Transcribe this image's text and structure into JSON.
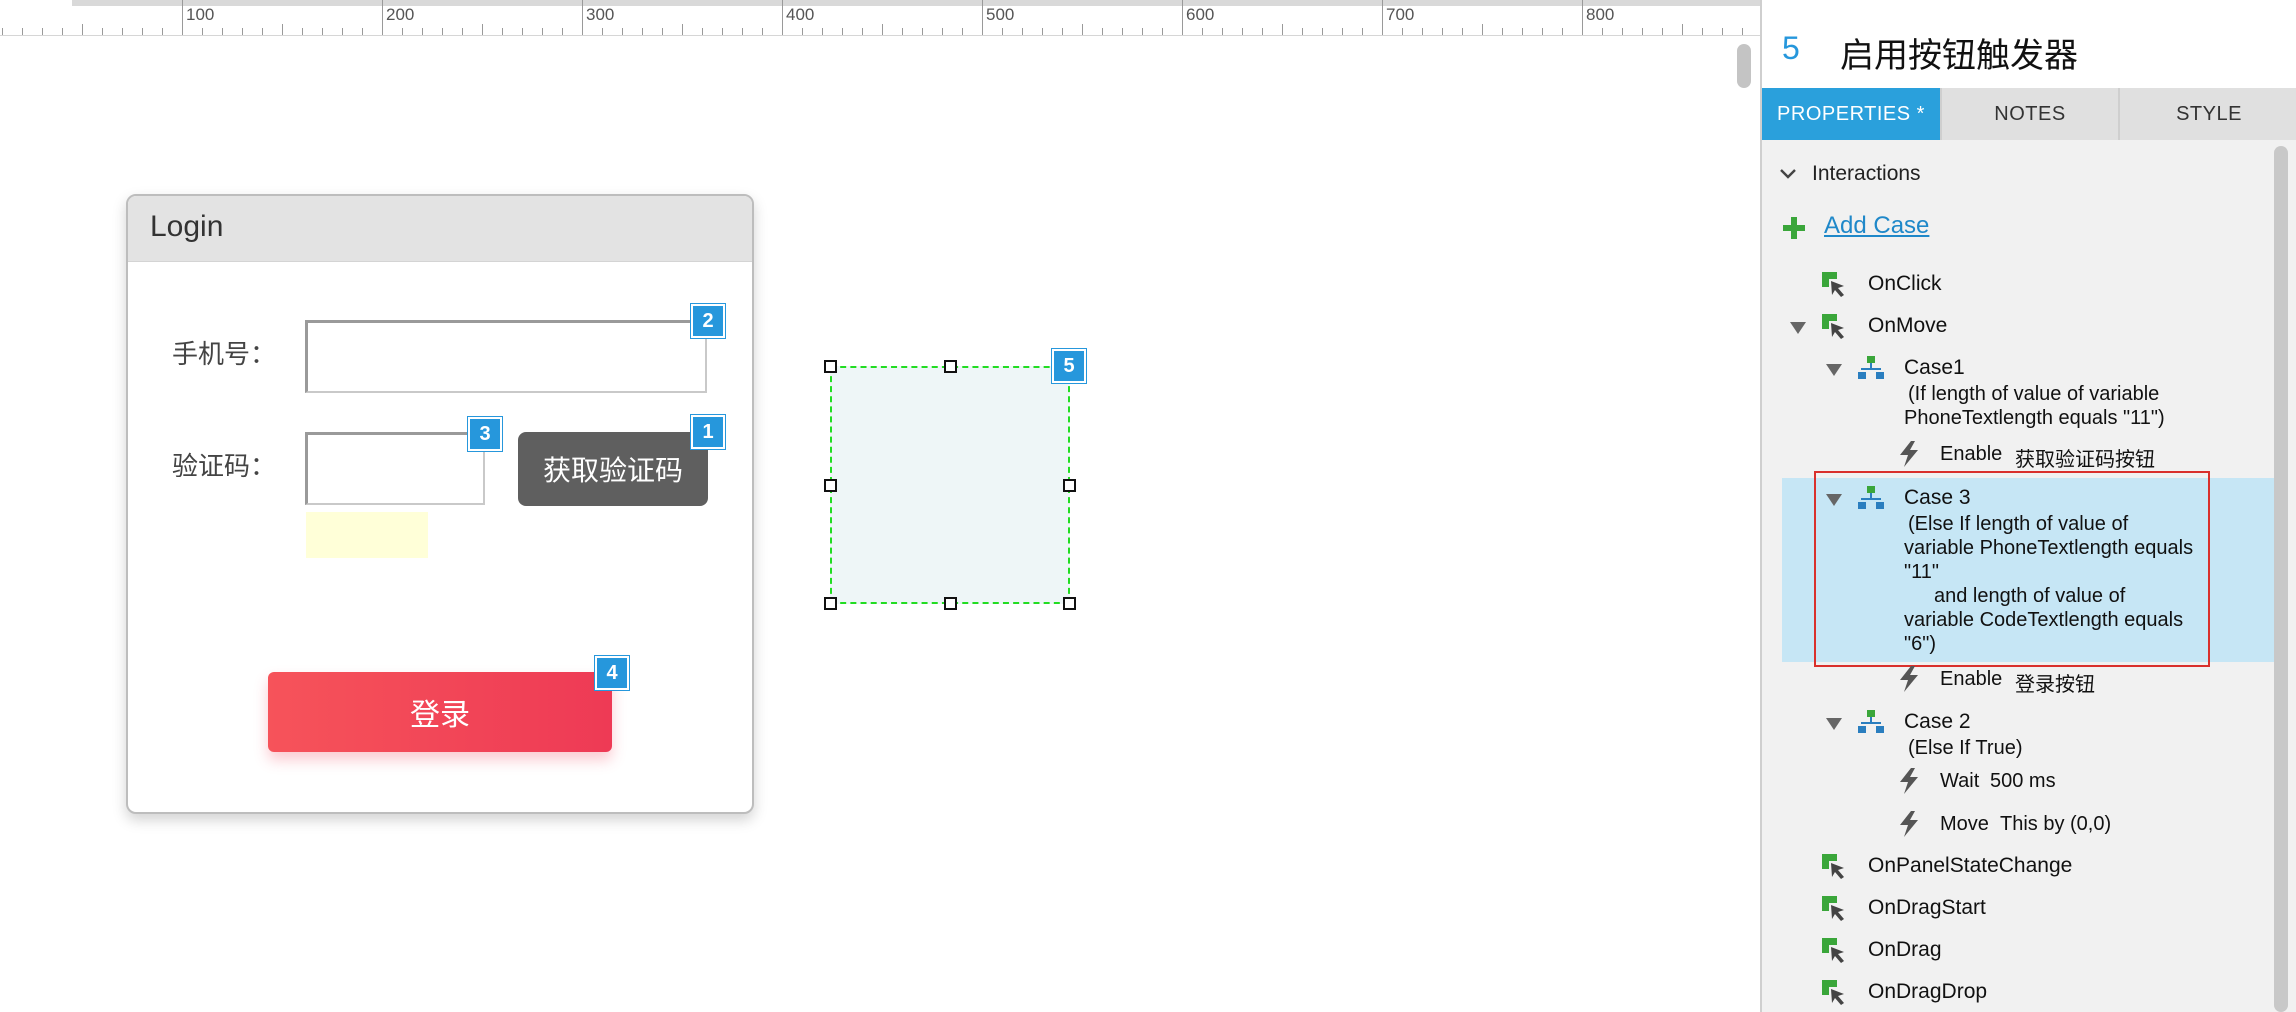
{
  "ruler": {
    "labels": [
      "100",
      "200",
      "300",
      "400",
      "500",
      "600",
      "700",
      "800"
    ]
  },
  "login_card": {
    "title": "Login",
    "phone_label": "手机号：",
    "code_label": "验证码：",
    "get_code_button": "获取验证码",
    "login_button": "登录",
    "footnotes": {
      "phone_field": "2",
      "code_field": "3",
      "get_code_button": "1",
      "login_button": "4"
    }
  },
  "hotspot": {
    "footnote": "5"
  },
  "panel": {
    "widget_number": "5",
    "widget_name": "启用按钮触发器",
    "tabs": [
      {
        "label": "PROPERTIES *",
        "active": true
      },
      {
        "label": "NOTES",
        "active": false
      },
      {
        "label": "STYLE",
        "active": false
      }
    ],
    "interactions_label": "Interactions",
    "add_case_label": "Add Case",
    "events": {
      "onclick": "OnClick",
      "onmove": "OnMove",
      "onpanelstatechange": "OnPanelStateChange",
      "ondragstart": "OnDragStart",
      "ondrag": "OnDrag",
      "ondragdrop": "OnDragDrop"
    },
    "case1": {
      "name": "Case1",
      "condition_1": "(If length of value of variable",
      "condition_2": "PhoneTextlength equals \"11\")",
      "action_verb": "Enable",
      "action_target": "获取验证码按钮"
    },
    "case3": {
      "name": "Case 3",
      "condition_1": "(Else If length of value of",
      "condition_2": "variable PhoneTextlength equals",
      "condition_3": "\"11\"",
      "condition_4": "and length of value of",
      "condition_5": "variable CodeTextlength equals",
      "condition_6": "\"6\")",
      "action_verb": "Enable",
      "action_target": "登录按钮"
    },
    "case2": {
      "name": "Case 2",
      "condition": "(Else If True)",
      "action1_verb": "Wait",
      "action1_value": "500 ms",
      "action2_verb": "Move",
      "action2_value": "This by (0,0)"
    }
  },
  "colors": {
    "accent": "#2aa0dc",
    "footnote": "#2697dc",
    "selection": "#22dd22",
    "highlight": "#c6e6f5",
    "outline": "#d9302c",
    "action_value": "#1a8a1a"
  }
}
